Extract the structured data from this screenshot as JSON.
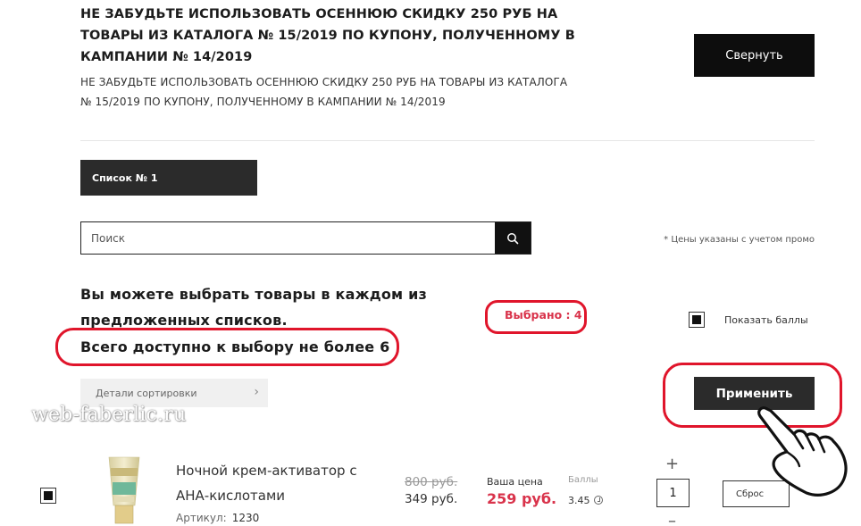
{
  "promo": {
    "title": "НЕ ЗАБУДЬТЕ ИСПОЛЬЗОВАТЬ ОСЕННЮЮ СКИДКУ 250 РУБ НА ТОВАРЫ ИЗ КАТАЛОГА № 15/2019 ПО КУПОНУ, ПОЛУЧЕННОМУ В КАМПАНИИ № 14/2019",
    "text": "НЕ ЗАБУДЬТЕ ИСПОЛЬЗОВАТЬ ОСЕННЮЮ СКИДКУ 250 РУБ НА ТОВАРЫ ИЗ КАТАЛОГА № 15/2019 ПО КУПОНУ, ПОЛУЧЕННОМУ В КАМПАНИИ № 14/2019",
    "collapse_label": "Свернуть"
  },
  "list_tab": "Список № 1",
  "search": {
    "placeholder": "Поиск",
    "icon": "search-icon"
  },
  "price_note": "* Цены указаны с учетом промо",
  "instructions": {
    "line1": "Вы можете выбрать товары в каждом из предложенных списков.",
    "line2": "Всего доступно к выбору не более 6"
  },
  "selected": "Выбрано : 4",
  "show_points": {
    "label": "Показать баллы",
    "checked": true
  },
  "sort_details": "Детали сортировки",
  "apply_label": "Применить",
  "watermark": "web-faberlic.ru",
  "product": {
    "checked": true,
    "name": "Ночной крем-активатор с АНА-кислотами",
    "article_label": "Артикул:",
    "article": "1230",
    "old_price": "800 руб.",
    "price": "349 руб.",
    "your_price_label": "Ваша цена",
    "your_price": "259 руб.",
    "points_label": "Баллы",
    "points": "3.45",
    "qty": "1",
    "plus": "+",
    "minus": "–",
    "reset_label": "Сброс"
  },
  "colors": {
    "accent_red": "#d9334b",
    "annotation_red": "#e0152b",
    "dark_button": "#2b2b2b",
    "black_button": "#0d0d0d"
  }
}
